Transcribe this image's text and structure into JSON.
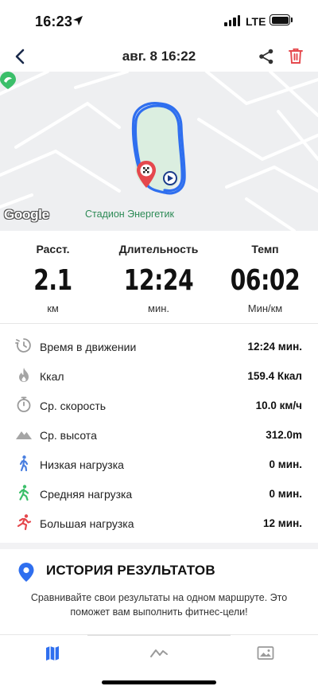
{
  "status_bar": {
    "time": "16:23",
    "network": "LTE"
  },
  "header": {
    "title": "авг. 8  16:22"
  },
  "map": {
    "provider_logo": "Google",
    "place_label": "Стадион Энергетик",
    "route_color": "#2f6fef"
  },
  "stats": [
    {
      "label": "Расст.",
      "value": "2.1",
      "unit": "км"
    },
    {
      "label": "Длительность",
      "value": "12:24",
      "unit": "мин."
    },
    {
      "label": "Темп",
      "value": "06:02",
      "unit": "Мин/км"
    }
  ],
  "details": [
    {
      "icon": "stopwatch-moving-icon",
      "label": "Время в движении",
      "value": "12:24 мин."
    },
    {
      "icon": "flame-icon",
      "label": "Ккал",
      "value": "159.4 Ккал"
    },
    {
      "icon": "timer-icon",
      "label": "Ср. скорость",
      "value": "10.0 км/ч"
    },
    {
      "icon": "mountain-icon",
      "label": "Ср. высота",
      "value": "312.0m"
    },
    {
      "icon": "walking-person-icon",
      "label": "Низкая нагрузка",
      "value": "0 мин."
    },
    {
      "icon": "walking-fast-person-icon",
      "label": "Средняя нагрузка",
      "value": "0 мин."
    },
    {
      "icon": "running-person-icon",
      "label": "Большая нагрузка",
      "value": "12 мин."
    }
  ],
  "history": {
    "title": "ИСТОРИЯ РЕЗУЛЬТАТОВ",
    "description": "Сравнивайте свои результаты на одном маршруте. Это поможет вам выполнить фитнес-цели!"
  },
  "tabs": [
    {
      "icon": "map-icon",
      "active": true
    },
    {
      "icon": "chart-line-icon",
      "active": false
    },
    {
      "icon": "image-icon",
      "active": false
    }
  ],
  "colors": {
    "accent": "#2f6fef",
    "danger": "#e5484d",
    "walk_low": "#4a7fe0",
    "walk_mid": "#3bbf6a",
    "walk_high": "#e5484d"
  }
}
